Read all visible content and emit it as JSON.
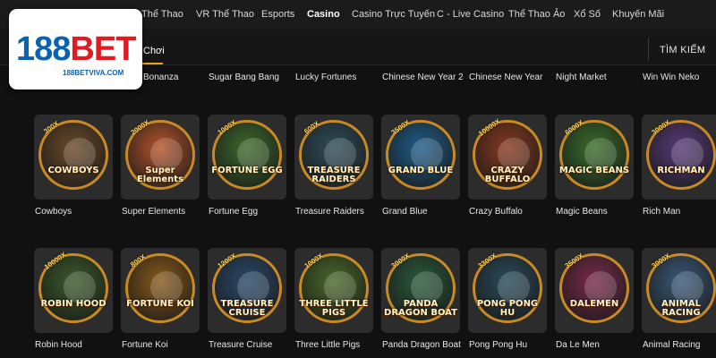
{
  "nav": [
    "Thể Thao",
    "VR Thể Thao",
    "Esports",
    "Casino",
    "Casino Trực Tuyến",
    "C - Live Casino",
    "Thể Thao Ảo",
    "Xổ Số",
    "Khuyến Mãi"
  ],
  "subtab": "Chơi",
  "search_label": "TÌM KIẾM",
  "logo": {
    "main_left": "188",
    "main_right": "BET",
    "sub": "188BETVIVA.COM"
  },
  "row0_labels": [
    "Bonanza",
    "Sugar Bang Bang",
    "Lucky Fortunes",
    "Chinese New Year 2",
    "Chinese New Year",
    "Night Market",
    "Win Win Neko"
  ],
  "games_row1": [
    {
      "name": "Cowboys",
      "title": "COWBOYS",
      "mult": "300X",
      "color": "#6b4a2a"
    },
    {
      "name": "Super Elements",
      "title": "Super Elements",
      "mult": "2000X",
      "color": "#b5552a"
    },
    {
      "name": "Fortune Egg",
      "title": "FORTUNE EGG",
      "mult": "1000X",
      "color": "#3d6a2a"
    },
    {
      "name": "Treasure Raiders",
      "title": "TREASURE RAIDERS",
      "mult": "600X",
      "color": "#2f4d5a"
    },
    {
      "name": "Grand Blue",
      "title": "GRAND BLUE",
      "mult": "3500X",
      "color": "#1f5e8a"
    },
    {
      "name": "Crazy Buffalo",
      "title": "CRAZY BUFFALO",
      "mult": "10000X",
      "color": "#8a3a1f"
    },
    {
      "name": "Magic Beans",
      "title": "MAGIC BEANS",
      "mult": "6000X",
      "color": "#3a6e2a"
    },
    {
      "name": "Rich Man",
      "title": "RICHMAN",
      "mult": "3000X",
      "color": "#5a3a7a"
    }
  ],
  "games_row2": [
    {
      "name": "Robin Hood",
      "title": "ROBIN HOOD",
      "mult": "10000X",
      "color": "#3a5a2a"
    },
    {
      "name": "Fortune Koi",
      "title": "FORTUNE KOI",
      "mult": "800X",
      "color": "#8a5a1a"
    },
    {
      "name": "Treasure Cruise",
      "title": "TREASURE CRUISE",
      "mult": "1200X",
      "color": "#2a4a6a"
    },
    {
      "name": "Three Little Pigs",
      "title": "THREE LITTLE PIGS",
      "mult": "1000X",
      "color": "#4a6a2a"
    },
    {
      "name": "Panda Dragon Boat",
      "title": "PANDA DRAGON BOAT",
      "mult": "3000X",
      "color": "#2a5a3a"
    },
    {
      "name": "Pong Pong Hu",
      "title": "PONG PONG HU",
      "mult": "3300X",
      "color": "#2a4a5a"
    },
    {
      "name": "Da Le Men",
      "title": "DALEMEN",
      "mult": "3500X",
      "color": "#7a2a4a"
    },
    {
      "name": "Animal Racing",
      "title": "ANIMAL RACING",
      "mult": "3000X",
      "color": "#3a5a7a"
    }
  ]
}
